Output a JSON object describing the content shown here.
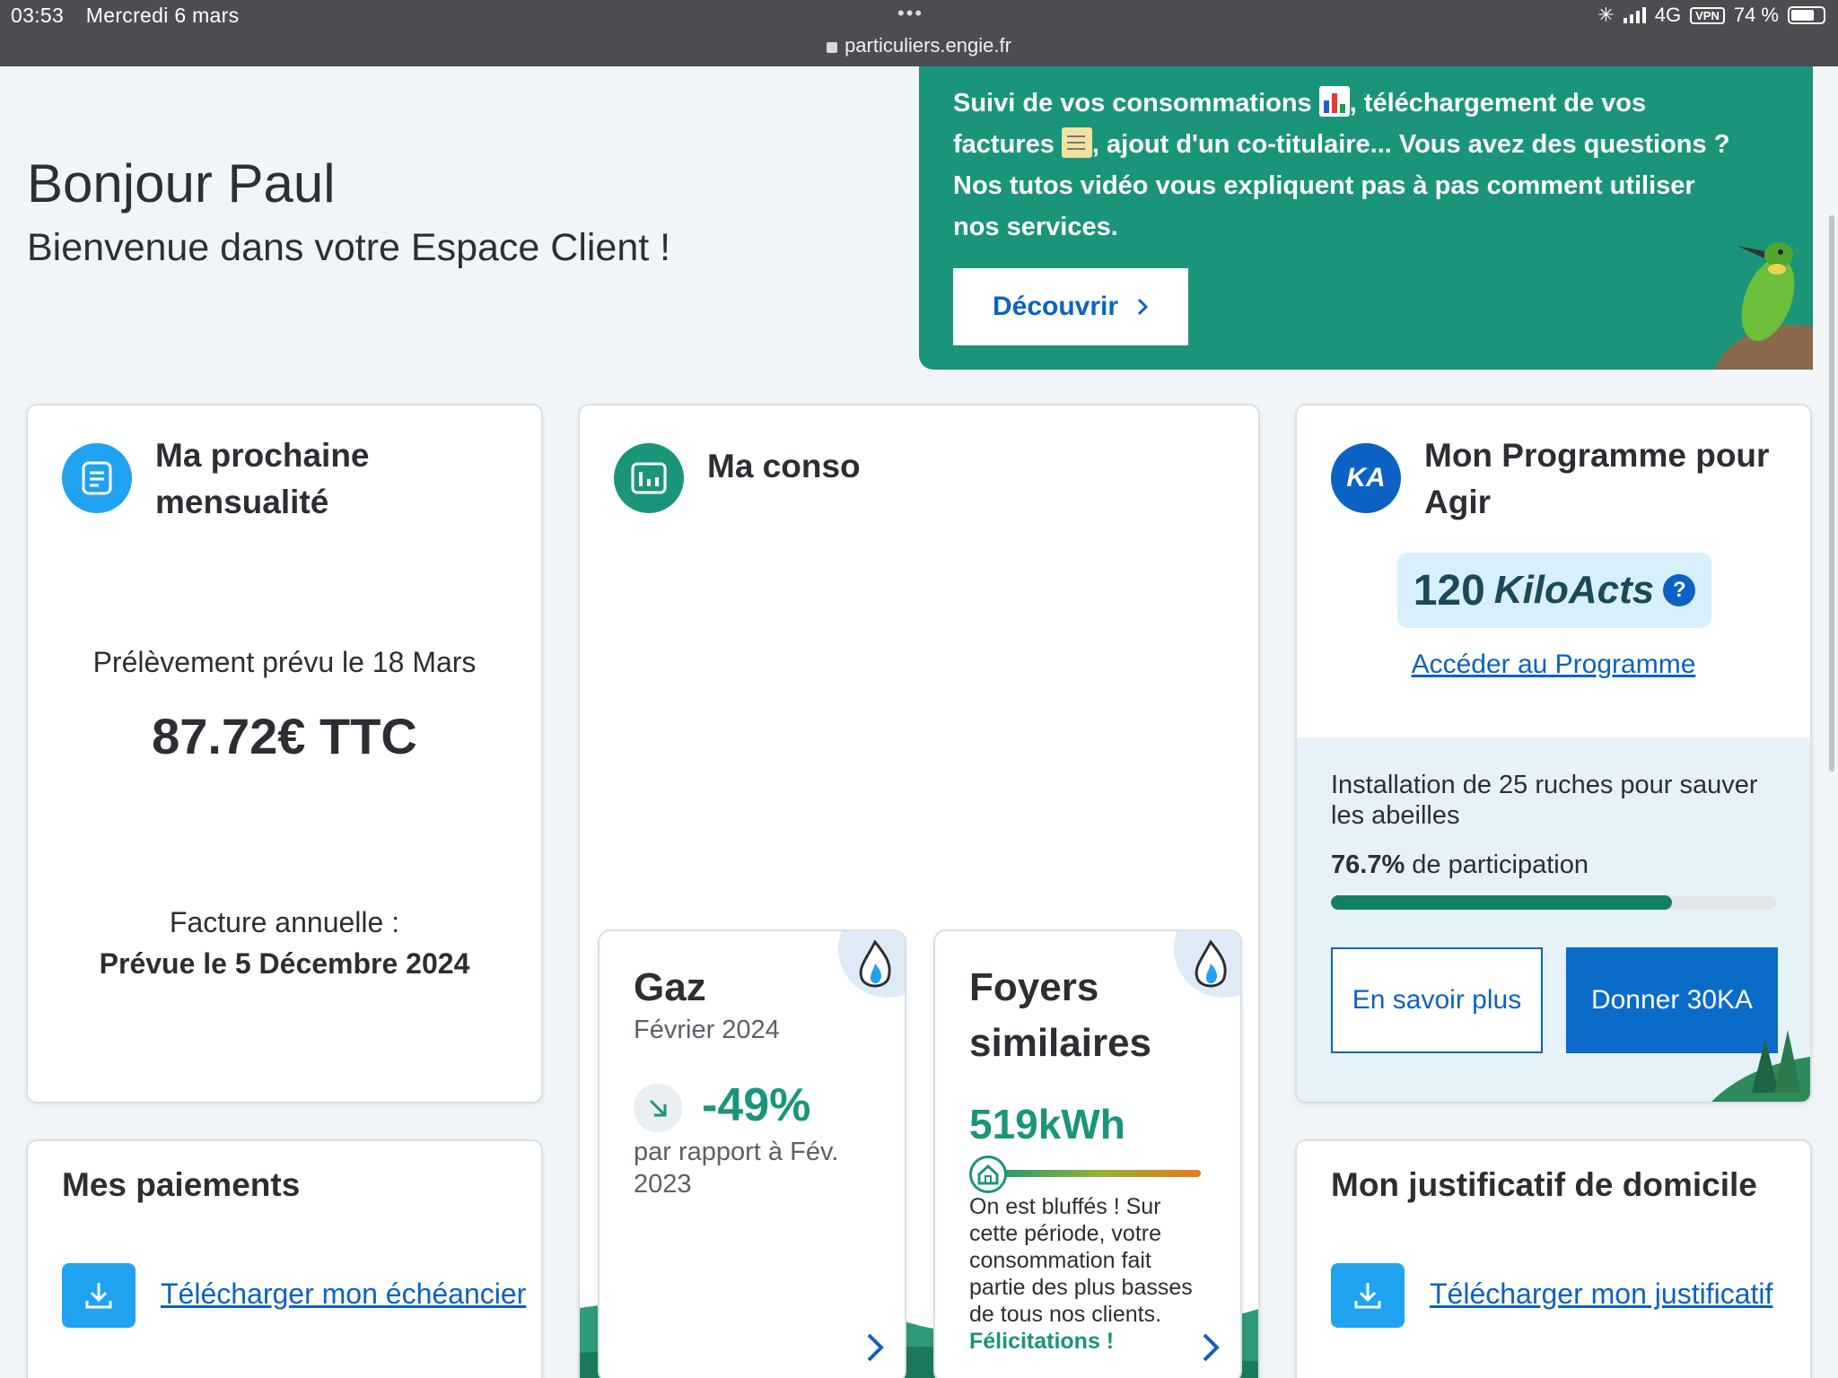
{
  "status_bar": {
    "time": "03:53",
    "date": "Mercredi 6 mars",
    "url": "particuliers.engie.fr",
    "network": "4G",
    "vpn": "VPN",
    "battery": "74 %",
    "battery_level": 0.74
  },
  "greeting": {
    "title": "Bonjour Paul",
    "subtitle": "Bienvenue dans votre Espace Client !"
  },
  "promo": {
    "text_part1": "Suivi de vos consommations",
    "text_part2": ", téléchargement de vos factures",
    "text_part3": ", ajout d'un co-titulaire... Vous avez des questions ? Nos tutos vidéo vous expliquent pas à pas comment utiliser nos services.",
    "button_label": "Découvrir"
  },
  "mensualite": {
    "title": "Ma prochaine mensualité",
    "prelevement": "Prélèvement prévu le 18 Mars",
    "amount": "87.72€ TTC",
    "facture_label": "Facture annuelle :",
    "facture_date": "Prévue le 5 Décembre 2024"
  },
  "conso": {
    "title": "Ma conso",
    "gas": {
      "title": "Gaz",
      "date": "Février 2024",
      "percent": "-49%",
      "comparison": "par rapport à Fév. 2023"
    },
    "foyers": {
      "title": "Foyers similaires",
      "value": "519kWh",
      "description": "On est bluffés ! Sur cette période, votre consommation fait partie des plus basses de tous nos clients.",
      "congrats": "Félicitations !"
    }
  },
  "programme": {
    "title": "Mon Programme pour Agir",
    "icon_text": "KA",
    "ka_value": "120",
    "ka_unit": "KiloActs",
    "help_icon": "?",
    "link_label": "Accéder au Programme",
    "project": "Installation de 25 ruches pour sauver les abeilles",
    "participation_value": "76.7%",
    "participation_label": "de participation",
    "participation_fraction": 0.767,
    "btn_info": "En savoir plus",
    "btn_donate": "Donner 30KA"
  },
  "paiements": {
    "title": "Mes paiements",
    "link_label": "Télécharger mon échéancier"
  },
  "justificatif": {
    "title": "Mon justificatif de domicile",
    "link_label": "Télécharger mon justificatif"
  },
  "colors": {
    "brand_green": "#1a9579",
    "brand_blue": "#0b62c2",
    "light_blue": "#1fa3f0"
  }
}
